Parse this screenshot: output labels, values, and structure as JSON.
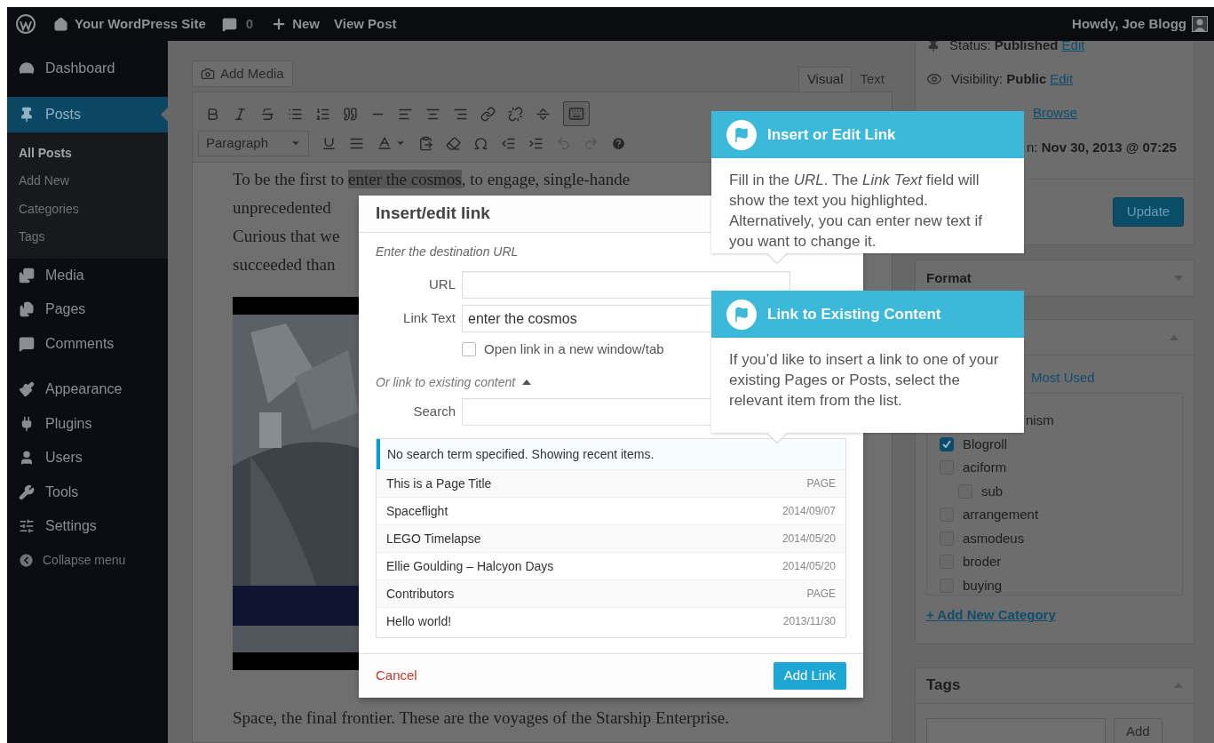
{
  "admin_bar": {
    "site": "Your WordPress Site",
    "comments": "0",
    "new": "New",
    "view": "View Post",
    "greeting": "Howdy, Joe Blogg"
  },
  "sidebar": {
    "items": [
      {
        "label": "Dashboard",
        "selected": false
      },
      {
        "label": "Posts",
        "selected": true,
        "children": [
          {
            "label": "All Posts",
            "selected": true
          },
          {
            "label": "Add New",
            "selected": false
          },
          {
            "label": "Categories",
            "selected": false
          },
          {
            "label": "Tags",
            "selected": false
          }
        ]
      },
      {
        "label": "Media",
        "selected": false
      },
      {
        "label": "Pages",
        "selected": false
      },
      {
        "label": "Comments",
        "selected": false
      },
      {
        "label": "Appearance",
        "selected": false
      },
      {
        "label": "Plugins",
        "selected": false
      },
      {
        "label": "Users",
        "selected": false
      },
      {
        "label": "Tools",
        "selected": false
      },
      {
        "label": "Settings",
        "selected": false
      }
    ],
    "collapse": "Collapse menu"
  },
  "editor": {
    "add_media": "Add Media",
    "tabs": [
      {
        "label": "Visual",
        "selected": true
      },
      {
        "label": "Text",
        "selected": false
      }
    ],
    "toolbar": {
      "format": "Paragraph",
      "toggle_selected": true,
      "undo_disabled": true,
      "redo_disabled": true
    },
    "lines": [
      {
        "before": "To be the first to ",
        "highlight": "enter the cosmos",
        "after": ", to engage, single-hande"
      },
      {
        "before": "unprecedented"
      },
      {
        "before": "Curious that we"
      },
      {
        "before": "succeeded than"
      }
    ],
    "after_text": "Space, the final frontier. These are the voyages of the Starship Enterprise."
  },
  "publish": {
    "status": "Status: **Published**",
    "status_link": "Edit",
    "visibility": "Visibility: **Public**",
    "visibility_link": "Edit",
    "revisions_link": "Browse",
    "published_on": "n: **Nov 30, 2013 @ 07:25**",
    "update": "Update"
  },
  "format_box": {
    "title": "Format",
    "expanded": false
  },
  "categories_box": {
    "expanded": true,
    "tab": "Most Used",
    "items": [
      {
        "kind": "text",
        "label": "nism"
      },
      {
        "kind": "checkbox",
        "label": "Blogroll",
        "checked": true
      },
      {
        "kind": "checkbox",
        "label": "aciform",
        "checked": false,
        "children": [
          {
            "kind": "checkbox",
            "label": "sub",
            "checked": false
          }
        ]
      },
      {
        "kind": "checkbox",
        "label": "arrangement",
        "checked": false
      },
      {
        "kind": "checkbox",
        "label": "asmodeus",
        "checked": false
      },
      {
        "kind": "checkbox",
        "label": "broder",
        "checked": false
      },
      {
        "kind": "checkbox",
        "label": "buying",
        "checked": false
      }
    ],
    "add_new": "+ Add New Category"
  },
  "tags_box": {
    "title": "Tags",
    "expanded": true,
    "add": "Add"
  },
  "dialog": {
    "title": "Insert/edit link",
    "intro": "Enter the destination URL",
    "url_label": "URL",
    "link_text_label": "Link Text",
    "link_text": "enter the cosmos",
    "new_tab_label": "Open link in a new window/tab",
    "new_tab": false,
    "existing": "Or link to existing content",
    "existing_expanded": true,
    "search_label": "Search",
    "notice": "No search term specified. Showing recent items.",
    "results": [
      {
        "title": "This is a Page Title",
        "info": "PAGE"
      },
      {
        "title": "Spaceflight",
        "info": "2014/09/07"
      },
      {
        "title": "LEGO Timelapse",
        "info": "2014/05/20"
      },
      {
        "title": "Ellie Goulding – Halcyon Days",
        "info": "2014/05/20"
      },
      {
        "title": "Contributors",
        "info": "PAGE"
      },
      {
        "title": "Hello world!",
        "info": "2013/11/30"
      }
    ],
    "cancel": "Cancel",
    "submit": "Add Link"
  },
  "tooltips": [
    {
      "title": "Insert or Edit Link",
      "body": "Fill in the *URL*. The *Link Text* field will show the text you highlighted. Alternatively, you can enter new text if you want to change it."
    },
    {
      "title": "Link to Existing Content",
      "body": "If you’d like to insert a link to one of your existing Pages or Posts, select the relevant item from the list."
    }
  ]
}
